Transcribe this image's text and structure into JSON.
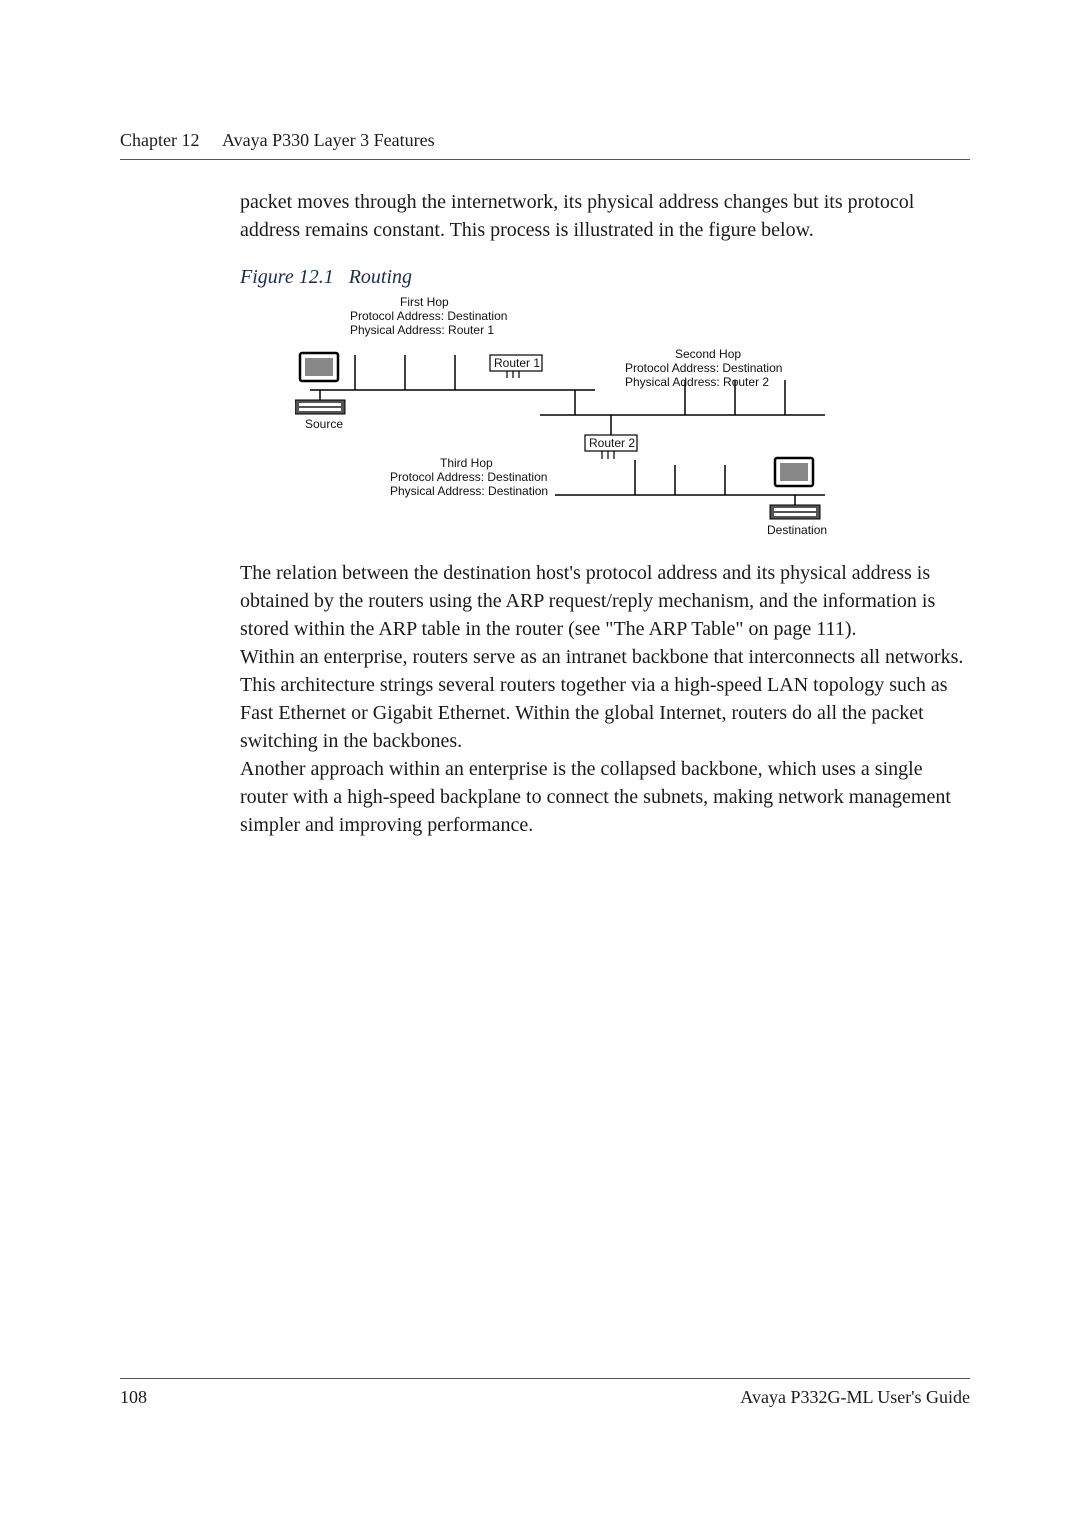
{
  "header": {
    "chapter_label": "Chapter 12",
    "chapter_title": "Avaya P330 Layer 3 Features"
  },
  "paragraphs": {
    "p1": "packet moves through the internetwork, its physical address changes but its protocol address remains constant. This process is illustrated in the figure below.",
    "p2": "The relation between the destination host's protocol address and its physical address is obtained by the routers using the ARP request/reply mechanism, and the information is stored within the ARP table in the router (see \"The ARP Table\" on page 111).",
    "p3": "Within an enterprise, routers serve as an intranet backbone that interconnects all networks. This architecture strings several routers together via a high-speed LAN topology such as Fast Ethernet or Gigabit Ethernet. Within the global Internet, routers do all the packet switching in the backbones.",
    "p4": "Another approach within an enterprise is the collapsed backbone, which uses a single router with a high-speed backplane to connect the subnets, making network management simpler and improving performance."
  },
  "figure": {
    "caption_prefix": "Figure 12.1",
    "caption_title": "Routing",
    "first_hop_title": "First Hop",
    "first_hop_proto": "Protocol Address:  Destination",
    "first_hop_phys": "Physical Address:  Router 1",
    "second_hop_title": "Second Hop",
    "second_hop_proto": "Protocol Address:  Destination",
    "second_hop_phys": "Physical Address:  Router 2",
    "third_hop_title": "Third Hop",
    "third_hop_proto": "Protocol Address:  Destination",
    "third_hop_phys": "Physical Address:  Destination",
    "router1": "Router 1",
    "router2": "Router 2",
    "source": "Source",
    "destination": "Destination"
  },
  "footer": {
    "page_number": "108",
    "guide_title": "Avaya P332G-ML User's Guide"
  }
}
